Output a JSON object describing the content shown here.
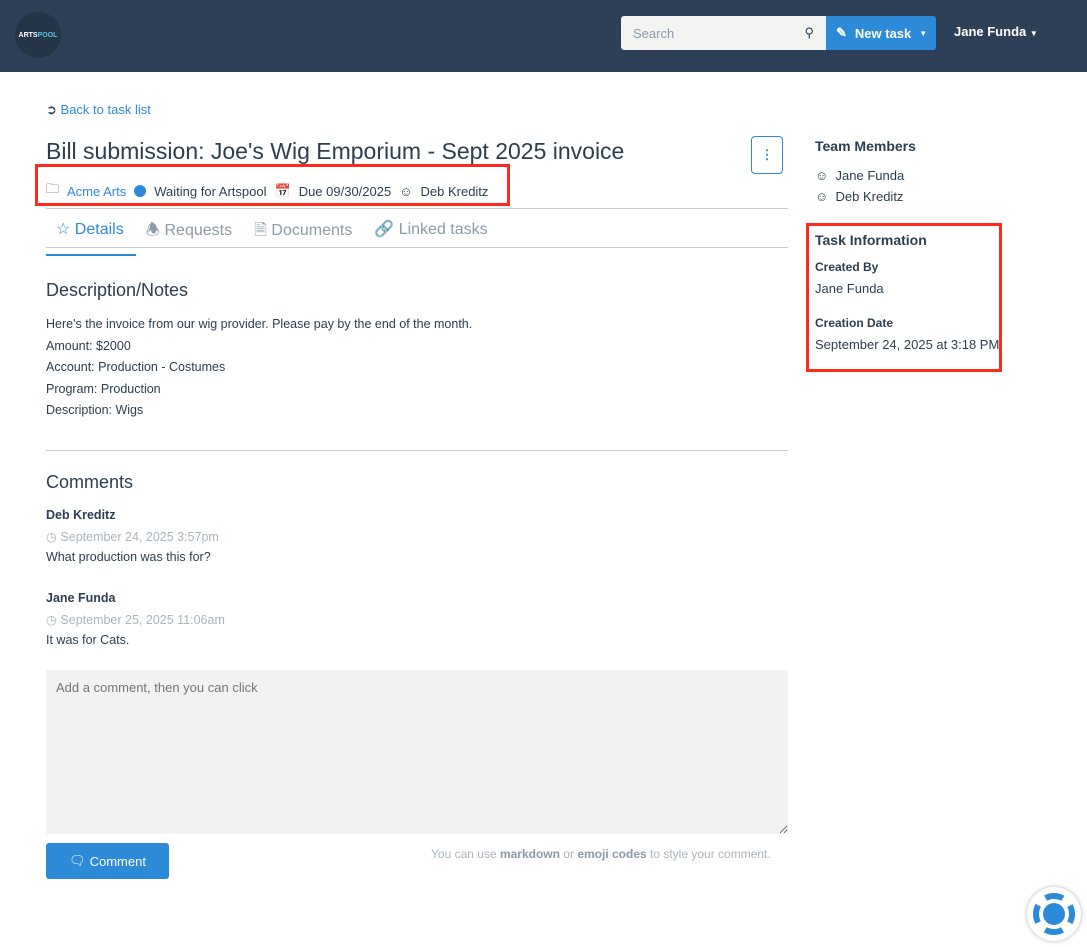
{
  "nav": {
    "logo": "ARTSPOOL",
    "logo_a": "ARTS",
    "logo_b": "POOL",
    "search_placeholder": "Search",
    "new_task": "New task",
    "user": "Jane Funda"
  },
  "back": "Back to task list",
  "title": "Bill submission: Joe's Wig Emporium - Sept 2025 invoice",
  "meta": {
    "org": "Acme Arts",
    "status": "Waiting for Artspool",
    "due": "Due 09/30/2025",
    "assignee": "Deb Kreditz",
    "status_color": "#2c8ad8"
  },
  "tabs": [
    {
      "label": "Details"
    },
    {
      "label": "Requests"
    },
    {
      "label": "Documents"
    },
    {
      "label": "Linked tasks"
    }
  ],
  "description": {
    "heading": "Description/Notes",
    "lines": [
      "Here's the invoice from our wig provider. Please pay by the end of the month.",
      "Amount: $2000",
      "Account: Production - Costumes",
      "Program: Production",
      "Description: Wigs"
    ]
  },
  "comments": {
    "heading": "Comments",
    "items": [
      {
        "author": "Deb Kreditz",
        "time": "September 24, 2025 3:57pm",
        "text": "What production was this for?"
      },
      {
        "author": "Jane Funda",
        "time": "September 25, 2025 11:06am",
        "text": "It was for Cats."
      }
    ],
    "placeholder": "Add a comment, then you can click",
    "button": "Comment",
    "hint_a": "You can use ",
    "hint_md": "markdown",
    "hint_or": " or ",
    "hint_emoji": "emoji codes",
    "hint_b": " to style your comment."
  },
  "sidebar": {
    "team_heading": "Team Members",
    "members": [
      "Jane Funda",
      "Deb Kreditz"
    ],
    "info_heading": "Task Information",
    "created_by_label": "Created By",
    "created_by": "Jane Funda",
    "creation_date_label": "Creation Date",
    "creation_date": "September 24, 2025 at 3:18 PM"
  }
}
